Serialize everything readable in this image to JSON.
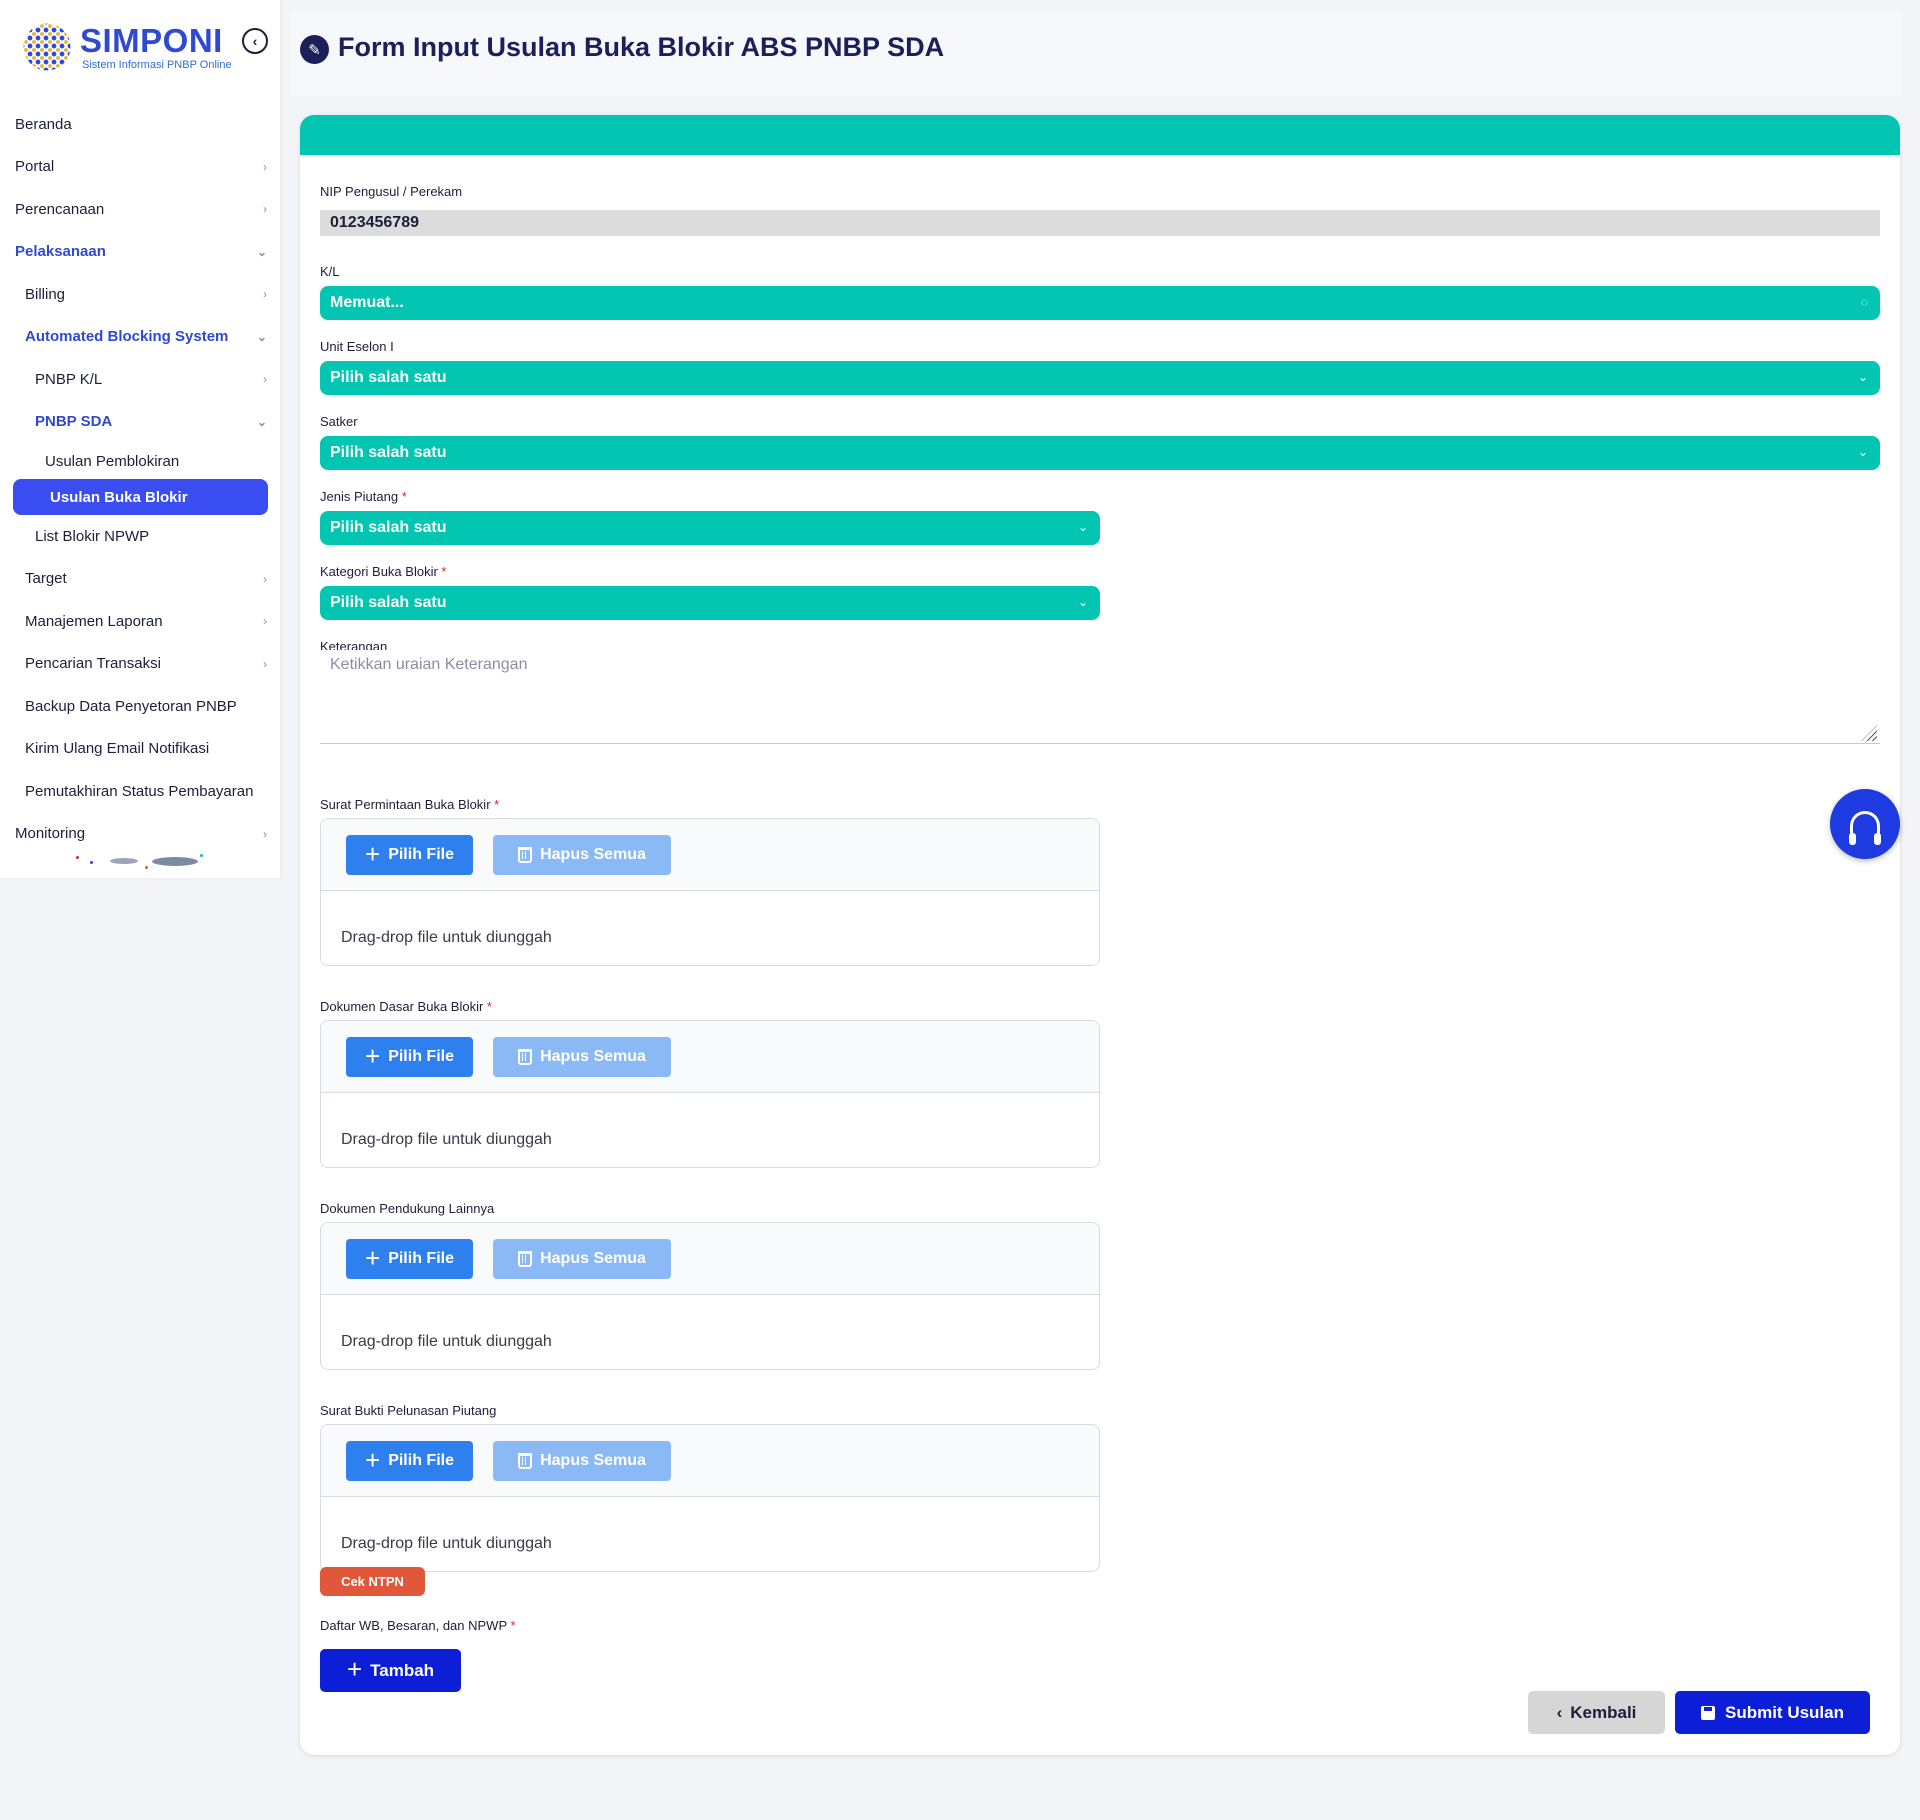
{
  "brand": {
    "name": "SIMPONI",
    "tagline": "Sistem Informasi PNBP Online"
  },
  "sidebar": {
    "items": [
      {
        "label": "Beranda",
        "level": 0,
        "chevron": ""
      },
      {
        "label": "Portal",
        "level": 0,
        "chevron": "›"
      },
      {
        "label": "Perencanaan",
        "level": 0,
        "chevron": "›"
      },
      {
        "label": "Pelaksanaan",
        "level": 0,
        "chevron": "⌄",
        "open": true
      },
      {
        "label": "Billing",
        "level": 1,
        "chevron": "›"
      },
      {
        "label": "Automated Blocking System",
        "level": 1,
        "chevron": "⌄",
        "open": true
      },
      {
        "label": "PNBP K/L",
        "level": 2,
        "chevron": "›"
      },
      {
        "label": "PNBP SDA",
        "level": 2,
        "chevron": "⌄",
        "open": true
      },
      {
        "label": "Usulan Pemblokiran",
        "level": 3,
        "chevron": ""
      },
      {
        "label": "Usulan Buka Blokir",
        "level": 3,
        "chevron": "",
        "active": true
      },
      {
        "label": "List Blokir NPWP",
        "level": 2,
        "chevron": ""
      },
      {
        "label": "Target",
        "level": 1,
        "chevron": "›"
      },
      {
        "label": "Manajemen Laporan",
        "level": 1,
        "chevron": "›"
      },
      {
        "label": "Pencarian Transaksi",
        "level": 1,
        "chevron": "›"
      },
      {
        "label": "Backup Data Penyetoran PNBP",
        "level": 1,
        "chevron": ""
      },
      {
        "label": "Kirim Ulang Email Notifikasi",
        "level": 1,
        "chevron": ""
      },
      {
        "label": "Pemutakhiran Status Pembayaran",
        "level": 1,
        "chevron": ""
      },
      {
        "label": "Monitoring",
        "level": 0,
        "chevron": "›"
      }
    ]
  },
  "header": {
    "title": "Form Input Usulan Buka Blokir ABS PNBP SDA"
  },
  "form": {
    "nip": {
      "label": "NIP Pengusul / Perekam",
      "value": "0123456789"
    },
    "kl": {
      "label": "K/L",
      "value": "Memuat..."
    },
    "eselon": {
      "label": "Unit Eselon I",
      "value": "Pilih salah satu"
    },
    "satker": {
      "label": "Satker",
      "value": "Pilih salah satu"
    },
    "jenis_piutang": {
      "label": "Jenis Piutang",
      "value": "Pilih salah satu"
    },
    "kategori": {
      "label": "Kategori Buka Blokir",
      "value": "Pilih salah satu"
    },
    "keterangan": {
      "label": "Keterangan",
      "placeholder": "Ketikkan uraian Keterangan"
    },
    "required_mark": "*",
    "uploads": [
      {
        "label": "Surat Permintaan Buka Blokir",
        "required": true
      },
      {
        "label": "Dokumen Dasar Buka Blokir",
        "required": true
      },
      {
        "label": "Dokumen Pendukung Lainnya",
        "required": false
      },
      {
        "label": "Surat Bukti Pelunasan Piutang",
        "required": false
      }
    ],
    "upload_pick_label": "Pilih File",
    "upload_clear_label": "Hapus Semua",
    "upload_drop_text": "Drag-drop file untuk diunggah",
    "cek_ntpn_label": "Cek NTPN",
    "daftar_label": "Daftar WB, Besaran, dan NPWP",
    "tambah_label": "Tambah",
    "kembali_label": "Kembali",
    "submit_label": "Submit Usulan"
  },
  "colors": {
    "accent": "#02c5b2",
    "primary": "#0d1fd6",
    "sidebar_active": "#3a4df0",
    "danger": "#e0573a"
  }
}
